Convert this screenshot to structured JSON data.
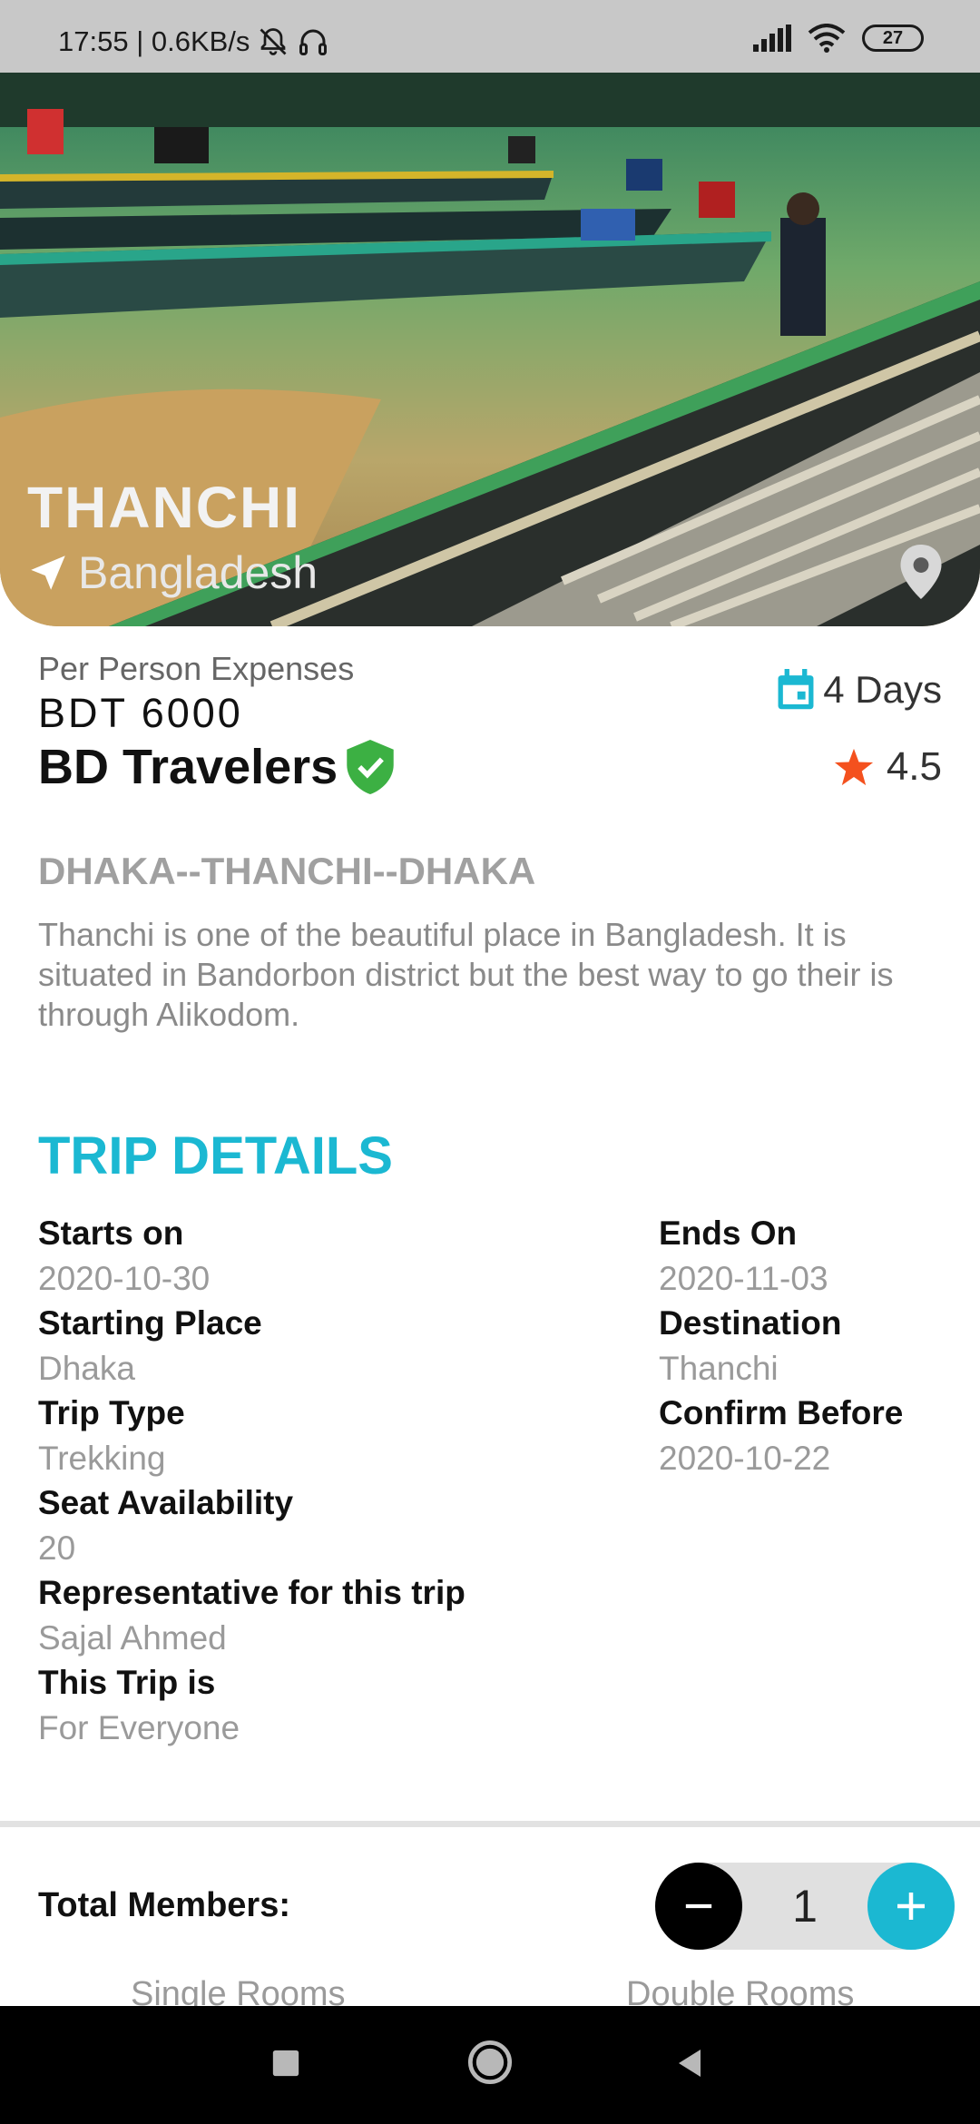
{
  "status_bar": {
    "time_speed": "17:55 | 0.6KB/s",
    "battery": "27"
  },
  "hero": {
    "title": "THANCHI",
    "country": "Bangladesh"
  },
  "pricing": {
    "label": "Per Person Expenses",
    "price": "BDT 6000"
  },
  "agency": {
    "name": "BD Travelers",
    "duration": "4 Days",
    "rating": "4.5"
  },
  "route": "DHAKA--THANCHI--DHAKA",
  "description": "Thanchi is one of the beautiful place in Bangladesh. It is situated in Bandorbon district but the best way to go their is through Alikodom.",
  "trip_details": {
    "title": "TRIP DETAILS",
    "left": [
      {
        "label": "Starts on",
        "value": "2020-10-30"
      },
      {
        "label": "Starting Place",
        "value": "Dhaka"
      },
      {
        "label": "Trip Type",
        "value": "Trekking"
      },
      {
        "label": "Seat Availability",
        "value": "20"
      },
      {
        "label": "Representative for this trip",
        "value": "Sajal Ahmed"
      },
      {
        "label": "This Trip is",
        "value": "For Everyone"
      }
    ],
    "right": [
      {
        "label": "Ends On",
        "value": "2020-11-03"
      },
      {
        "label": "Destination",
        "value": "Thanchi"
      },
      {
        "label": "Confirm Before",
        "value": "2020-10-22"
      }
    ]
  },
  "booking": {
    "members_label": "Total Members:",
    "members_count": "1",
    "single_rooms_label": "Single Rooms",
    "double_rooms_label": "Double Rooms"
  },
  "icons": {
    "accent_color": "#1bb8d2",
    "verified_color": "#3cb043",
    "star_color": "#f4511e"
  }
}
